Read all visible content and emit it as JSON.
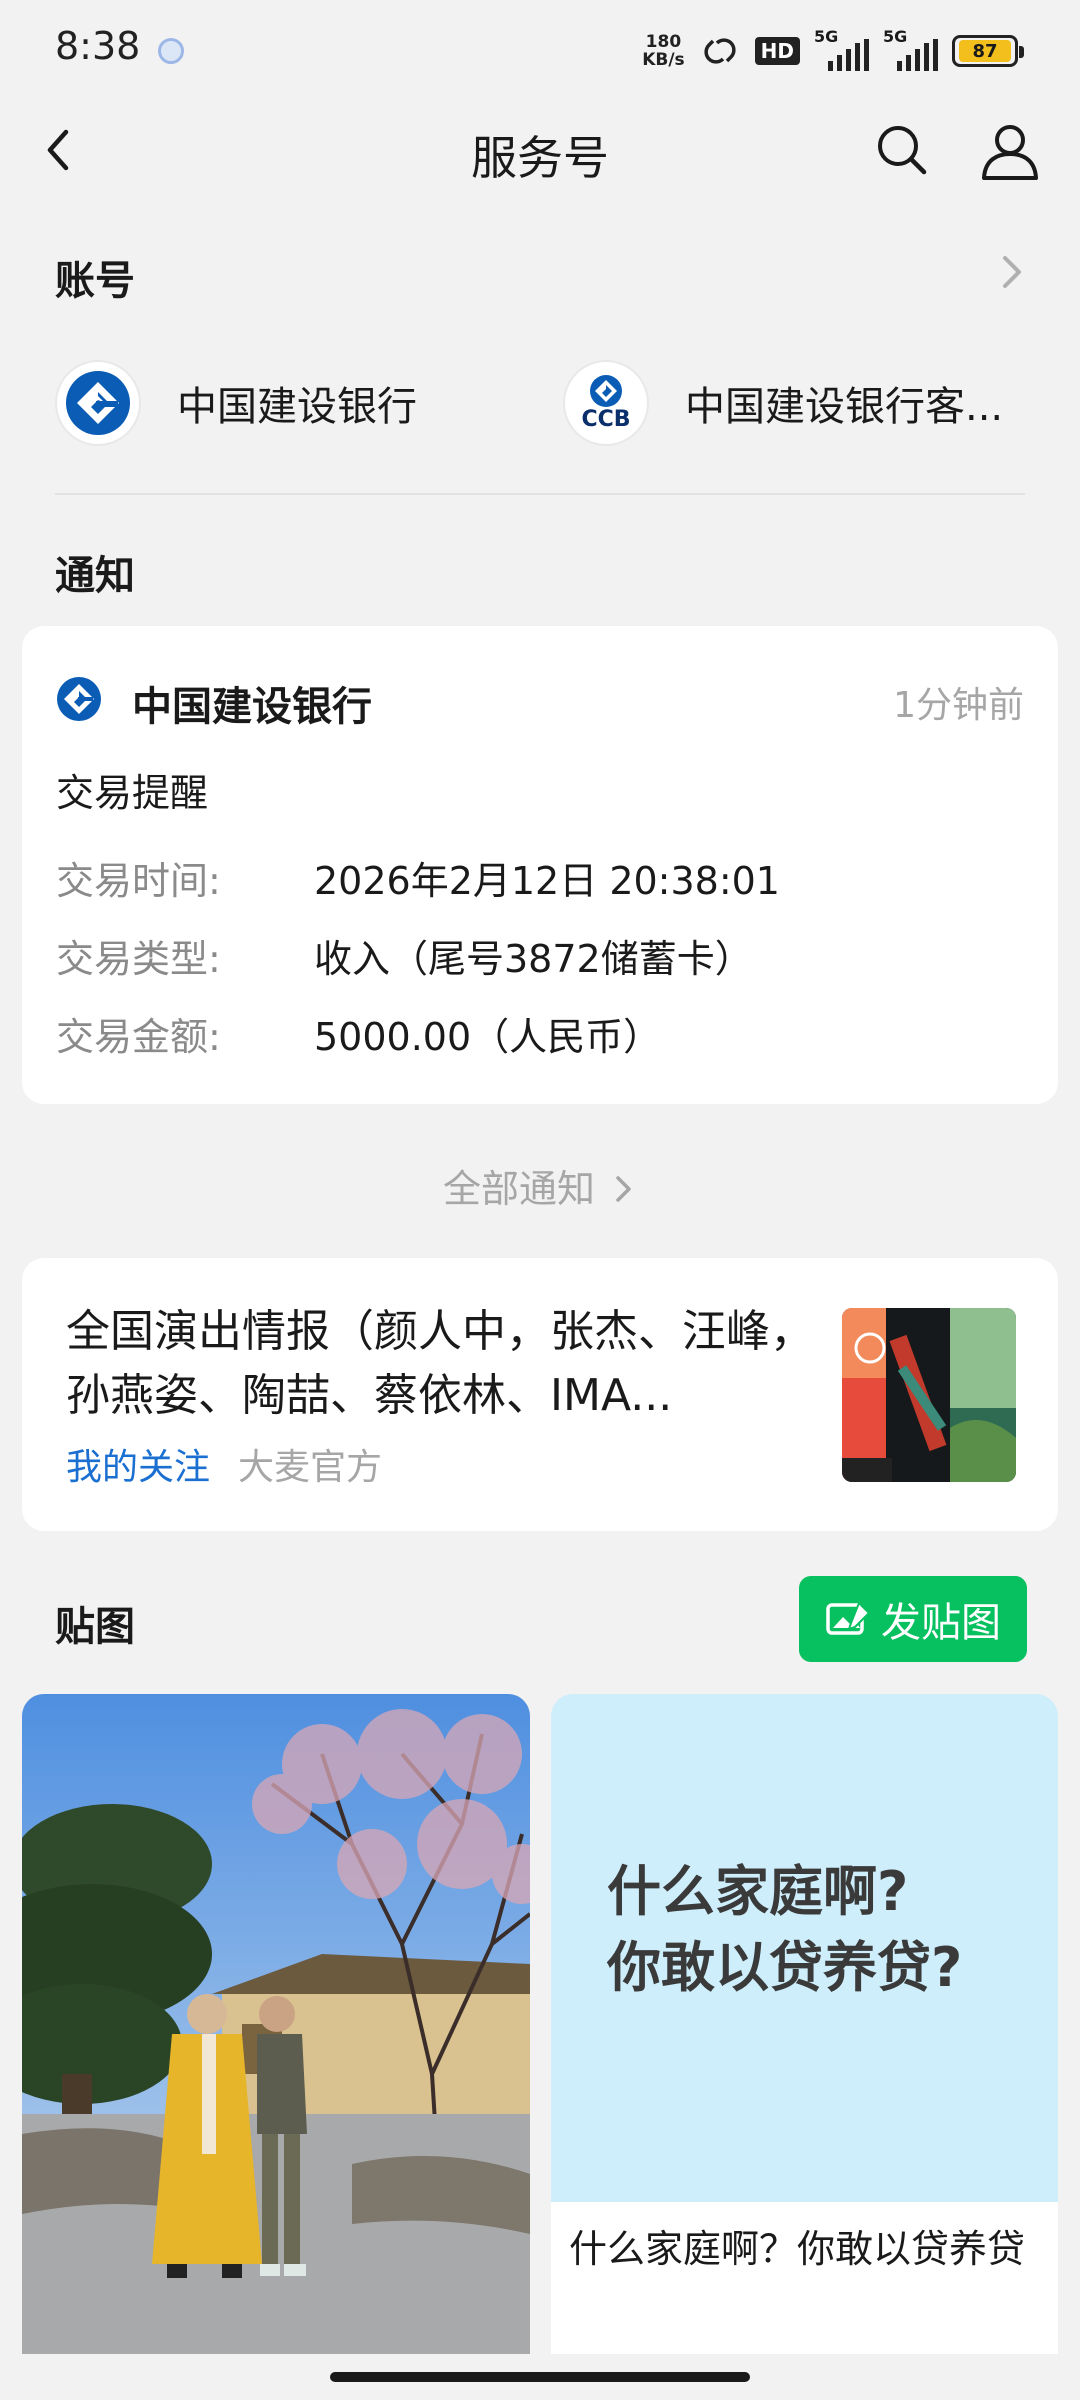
{
  "status_bar": {
    "time": "8:38",
    "net_speed_top": "180",
    "net_speed_bottom": "KB/s",
    "hd_label": "HD",
    "sig1_label": "5G",
    "sig2_label": "5G",
    "battery": "87"
  },
  "header": {
    "title": "服务号"
  },
  "accounts": {
    "section_title": "账号",
    "items": [
      {
        "name": "中国建设银行"
      },
      {
        "name": "中国建设银行客...",
        "logo_text": "CCB"
      }
    ]
  },
  "notifications": {
    "section_title": "通知",
    "card": {
      "sender": "中国建设银行",
      "time": "1分钟前",
      "title": "交易提醒",
      "rows": [
        {
          "label": "交易时间:",
          "value": "2026年2月12日 20:38:01"
        },
        {
          "label": "交易类型:",
          "value": "收入（尾号3872储蓄卡）"
        },
        {
          "label": "交易金额:",
          "value": "5000.00（人民币）"
        }
      ]
    },
    "all_link": "全部通知"
  },
  "article": {
    "title": "全国演出情报（颜人中，张杰、汪峰，孙燕姿、陶喆、蔡依林、IMA...",
    "tag_follow": "我的关注",
    "tag_source": "大麦官方"
  },
  "stickers": {
    "section_title": "贴图",
    "post_button": "发贴图",
    "text_card": {
      "big_line1": "什么家庭啊?",
      "big_line2": "你敢以贷养贷?",
      "caption": "什么家庭啊？你敢以贷养贷"
    }
  },
  "colors": {
    "accent_green": "#07c160",
    "link_blue": "#1a6fd1",
    "ccb_blue": "#0b5cb5"
  }
}
